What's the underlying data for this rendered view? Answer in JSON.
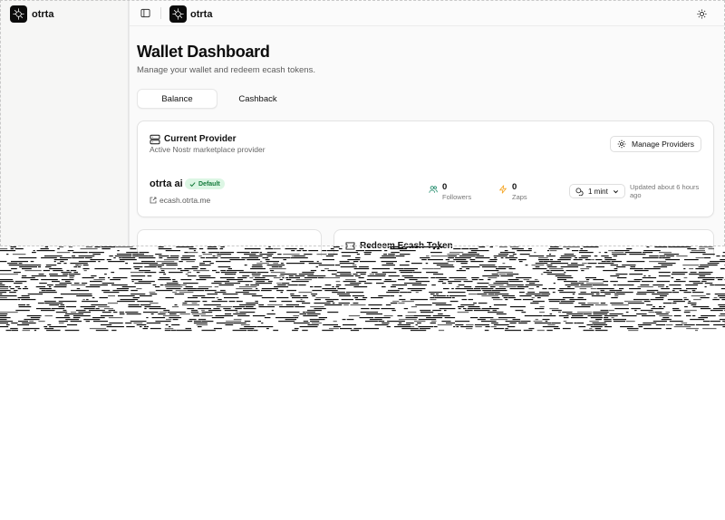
{
  "app": {
    "name": "otrta"
  },
  "header": {
    "brand": "otrta"
  },
  "page": {
    "title": "Wallet Dashboard",
    "subtitle": "Manage your wallet and redeem ecash tokens."
  },
  "tabs": [
    {
      "label": "Balance",
      "active": true
    },
    {
      "label": "Cashback",
      "active": false
    }
  ],
  "provider_card": {
    "title": "Current Provider",
    "description": "Active Nostr marketplace provider",
    "manage_label": "Manage Providers",
    "provider_name": "otrta ai",
    "badge": "Default",
    "link": "ecash.otrta.me",
    "followers": {
      "value": "0",
      "label": "Followers"
    },
    "zaps": {
      "value": "0",
      "label": "Zaps"
    },
    "mint_label": "1 mint",
    "updated": "Updated about 6 hours ago"
  },
  "lower_cards": {
    "right_title": "Redeem Ecash Token"
  },
  "colors": {
    "badge_bg": "#dcf6e4",
    "badge_text": "#137a3b",
    "zap_icon": "#f5a524",
    "followers_icon": "#1f8a6a"
  }
}
